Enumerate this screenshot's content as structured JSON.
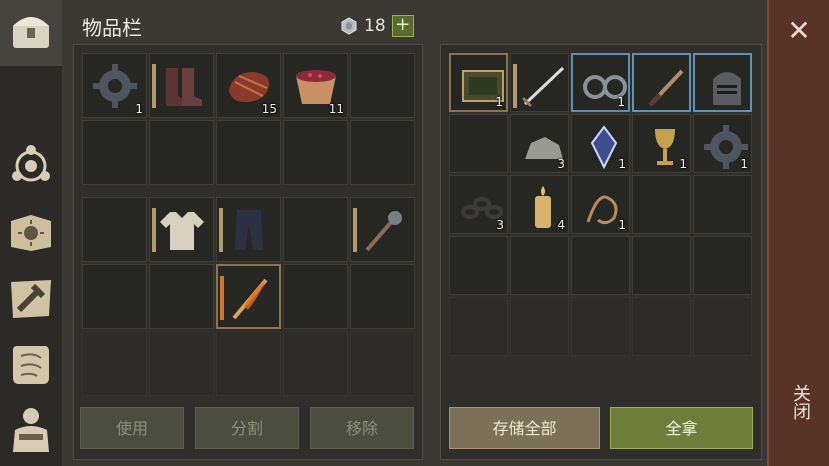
{
  "header": {
    "title": "物品栏",
    "coin_icon": "silver-coin-icon",
    "coin_count": "18",
    "plus_label": "+"
  },
  "sidebar": {
    "items": [
      {
        "name": "chest-tab",
        "icon": "chest-icon"
      },
      {
        "name": "skills-tab",
        "icon": "atom-icon"
      },
      {
        "name": "sun-book-tab",
        "icon": "sun-book-icon"
      },
      {
        "name": "craft-tab",
        "icon": "hammer-map-icon"
      },
      {
        "name": "scroll-tab",
        "icon": "scroll-icon"
      },
      {
        "name": "character-tab",
        "icon": "character-icon"
      }
    ]
  },
  "inventory": {
    "top_rows": [
      [
        {
          "icon": "gear-icon",
          "qty": "1"
        },
        {
          "icon": "boots-icon",
          "qty": ""
        },
        {
          "icon": "steak-icon",
          "qty": "15"
        },
        {
          "icon": "berry-bowl-icon",
          "qty": "11"
        },
        {
          "icon": "",
          "qty": ""
        }
      ],
      [
        {
          "icon": "",
          "qty": ""
        },
        {
          "icon": "",
          "qty": ""
        },
        {
          "icon": "",
          "qty": ""
        },
        {
          "icon": "",
          "qty": ""
        },
        {
          "icon": "",
          "qty": ""
        }
      ]
    ],
    "bottom_rows": [
      [
        {
          "icon": "",
          "qty": ""
        },
        {
          "icon": "shirt-icon",
          "qty": ""
        },
        {
          "icon": "pants-icon",
          "qty": ""
        },
        {
          "icon": "",
          "qty": ""
        },
        {
          "icon": "mace-icon",
          "qty": ""
        }
      ],
      [
        {
          "icon": "",
          "qty": ""
        },
        {
          "icon": "",
          "qty": ""
        },
        {
          "icon": "flame-sword-icon",
          "qty": ""
        },
        {
          "icon": "",
          "qty": ""
        },
        {
          "icon": "",
          "qty": ""
        }
      ],
      [
        {
          "icon": "",
          "qty": ""
        },
        {
          "icon": "",
          "qty": ""
        },
        {
          "icon": "",
          "qty": ""
        },
        {
          "icon": "",
          "qty": ""
        },
        {
          "icon": "",
          "qty": ""
        }
      ]
    ]
  },
  "storage": {
    "rows": [
      [
        {
          "icon": "tray-icon",
          "qty": "1"
        },
        {
          "icon": "sword-icon",
          "qty": ""
        },
        {
          "icon": "shackles-icon",
          "qty": "1"
        },
        {
          "icon": "knife-icon",
          "qty": ""
        },
        {
          "icon": "knight-helmet-icon",
          "qty": ""
        }
      ],
      [
        {
          "icon": "",
          "qty": ""
        },
        {
          "icon": "stone-icon",
          "qty": "3"
        },
        {
          "icon": "crystal-icon",
          "qty": "1"
        },
        {
          "icon": "goblet-icon",
          "qty": "1"
        },
        {
          "icon": "gear-icon",
          "qty": "1"
        }
      ],
      [
        {
          "icon": "chain-icon",
          "qty": "3"
        },
        {
          "icon": "candle-icon",
          "qty": "4"
        },
        {
          "icon": "rope-icon",
          "qty": "1"
        },
        {
          "icon": "",
          "qty": ""
        },
        {
          "icon": "",
          "qty": ""
        }
      ],
      [
        {
          "icon": "",
          "qty": ""
        },
        {
          "icon": "",
          "qty": ""
        },
        {
          "icon": "",
          "qty": ""
        },
        {
          "icon": "",
          "qty": ""
        },
        {
          "icon": "",
          "qty": ""
        }
      ],
      [
        {
          "icon": "",
          "qty": ""
        },
        {
          "icon": "",
          "qty": ""
        },
        {
          "icon": "",
          "qty": ""
        },
        {
          "icon": "",
          "qty": ""
        },
        {
          "icon": "",
          "qty": ""
        }
      ]
    ]
  },
  "buttons": {
    "use": "使用",
    "split": "分割",
    "remove": "移除",
    "store_all": "存储全部",
    "take_all": "全拿"
  },
  "close": {
    "icon": "close-icon",
    "label": "关闭"
  },
  "colors": {
    "accent_green": "#6f7e3b",
    "close_rail": "#5a3328"
  }
}
